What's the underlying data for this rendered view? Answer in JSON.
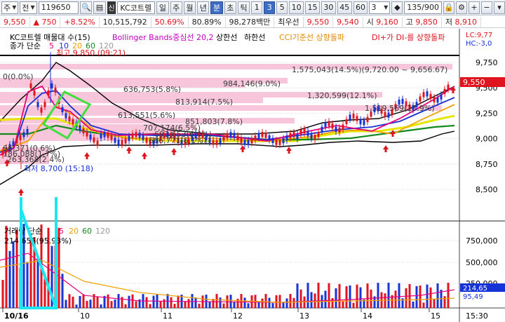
{
  "toolbar": {
    "type_label": "주",
    "mode_label": "전",
    "code": "119650",
    "sin": "신",
    "name": "KC코트렐",
    "periods": [
      "일",
      "주",
      "월",
      "년",
      "분",
      "초",
      "틱"
    ],
    "active_period": "분",
    "minutes": [
      "1",
      "3",
      "5",
      "10",
      "15",
      "30",
      "45",
      "60"
    ],
    "active_minute": "3",
    "interval_value": "3",
    "count": "135/900"
  },
  "quote": {
    "price": "9,550",
    "change": "750",
    "change_pct": "+8.52%",
    "volume": "10,515,792",
    "rate1": "50.69%",
    "rate2": "80.89%",
    "amount": "98,278백만",
    "best_label": "최우선",
    "ask": "9,550",
    "bid": "9,540",
    "open_label": "시",
    "open": "9,160",
    "high_label": "고",
    "high": "9,850",
    "low_label": "저",
    "low": "8,910"
  },
  "legends": {
    "price_title": "KC코트렐 매물대 수(15)",
    "bollinger": "Bollinger Bands중심선 20,2",
    "upper": "상한선",
    "lower": "하한선",
    "cci": "CCI기준선 상향돌파",
    "di": "DI+가 DI-를 상향돌파",
    "ma_label": "종가 단순",
    "ma_periods": [
      "5",
      "10",
      "20",
      "60",
      "120"
    ],
    "vol_label": "거래량 단순",
    "vol_periods": [
      "5",
      "20",
      "60",
      "120"
    ],
    "vol_value": "214,655(95.93%)",
    "right_top1": "LC:9,77",
    "right_top2": "HC:-3,0"
  },
  "annotations": {
    "high_mark": "최고 9,850 (09:21)",
    "low_mark": "최저 8,700 (15:18)",
    "band_labels": [
      "0(0.0%)",
      "1,575,043(14.5%)(9,720.00 ~ 9,656.67)",
      "984,146(9.0%)",
      "636,753(5.8%)",
      "1,320,599(12.1%)",
      "813,914(7.5%)",
      "1,519,569(13.9%)",
      "613,551(5.6%)",
      "851,803(7.8%)",
      "707,174(6.5%)",
      "693,653(6.4%)",
      "666,771(6.1%)",
      "66,371(0.6%)",
      "186,088(1.7%)",
      "263,368(2.4%)"
    ]
  },
  "axes": {
    "price_ticks": [
      "9,750",
      "9,500",
      "9,250",
      "9,000",
      "8,750",
      "8,500"
    ],
    "current_price_tag": "9,550",
    "volume_ticks": [
      "750,000",
      "500,000",
      "250,000"
    ],
    "volume_tag1": "214,65",
    "volume_tag2": "95,49",
    "x_ticks": [
      "10/16",
      "10",
      "11",
      "12",
      "13",
      "14",
      "15"
    ],
    "time_tag": "15:30"
  },
  "colors": {
    "up": "#e0141e",
    "down": "#1533d6",
    "ma5": "#e8007a",
    "ma10": "#1a2fd0",
    "ma20": "#f0a000",
    "ma60": "#138a1e",
    "ma120": "#9a9a9a",
    "bollinger_mid": "#e6e600",
    "bollinger_band": "#000000",
    "profile": "#f7c6da",
    "overlay_green": "#3ee03e",
    "overlay_cyan": "#19e6f0"
  }
}
